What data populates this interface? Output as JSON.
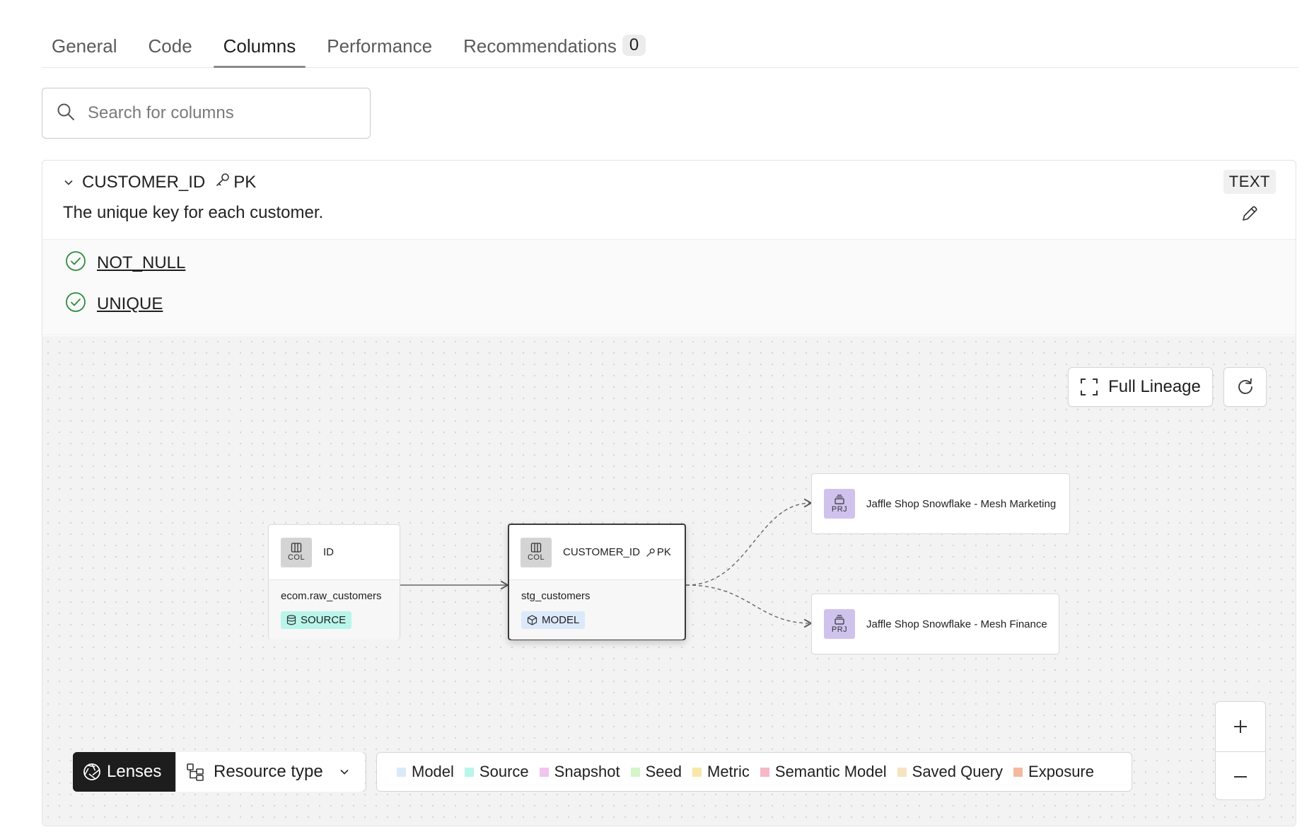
{
  "tabs": [
    {
      "label": "General"
    },
    {
      "label": "Code"
    },
    {
      "label": "Columns"
    },
    {
      "label": "Performance"
    },
    {
      "label": "Recommendations",
      "count": "0"
    }
  ],
  "search": {
    "placeholder": "Search for columns"
  },
  "column": {
    "name": "CUSTOMER_ID",
    "pk_label": "PK",
    "description": "The unique key for each customer.",
    "type": "TEXT",
    "tests": [
      {
        "name": "NOT_NULL"
      },
      {
        "name": "UNIQUE"
      }
    ]
  },
  "lineage": {
    "full_lineage_label": "Full Lineage",
    "col_badge": "COL",
    "prj_badge": "PRJ",
    "source_node": {
      "column": "ID",
      "resource": "ecom.raw_customers",
      "type_label": "SOURCE"
    },
    "model_node": {
      "column": "CUSTOMER_ID",
      "pk_label": "PK",
      "resource": "stg_customers",
      "type_label": "MODEL"
    },
    "project_nodes": [
      {
        "label": "Jaffle Shop Snowflake - Mesh Marketing"
      },
      {
        "label": "Jaffle Shop Snowflake - Mesh Finance"
      }
    ],
    "lenses_label": "Lenses",
    "resource_type_label": "Resource type",
    "legend": [
      {
        "label": "Model",
        "color": "#dbe9fb"
      },
      {
        "label": "Source",
        "color": "#b9f5ea"
      },
      {
        "label": "Snapshot",
        "color": "#f2c4ee"
      },
      {
        "label": "Seed",
        "color": "#d3f5c8"
      },
      {
        "label": "Metric",
        "color": "#f9e6a8"
      },
      {
        "label": "Semantic Model",
        "color": "#f5b8c6"
      },
      {
        "label": "Saved Query",
        "color": "#f7e3c2"
      },
      {
        "label": "Exposure",
        "color": "#f4b9a0"
      }
    ],
    "colors": {
      "source_chip": "#b9f5ea",
      "model_chip": "#dbe9fb",
      "prj_icon": "#cfc3ee"
    }
  }
}
